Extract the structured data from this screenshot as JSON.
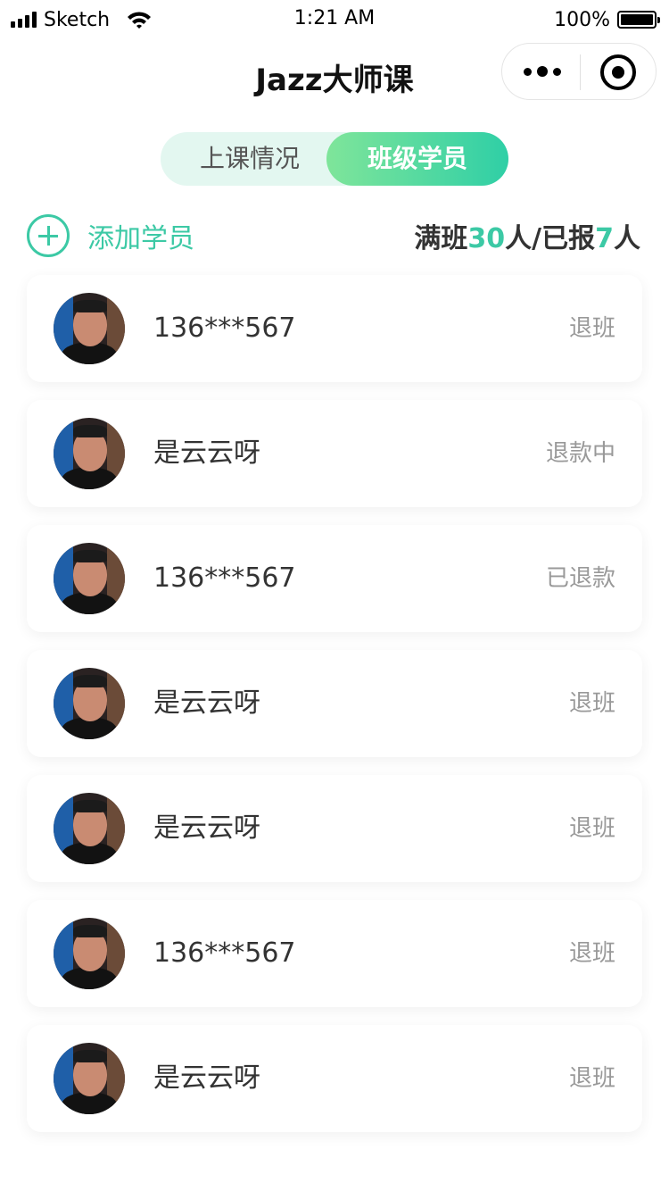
{
  "status_bar": {
    "carrier": "Sketch",
    "time": "1:21 AM",
    "battery": "100%"
  },
  "nav": {
    "title": "Jazz大师课"
  },
  "tabs": [
    {
      "label": "上课情况",
      "active": false
    },
    {
      "label": "班级学员",
      "active": true
    }
  ],
  "actions": {
    "add_label": "添加学员",
    "capacity_prefix": "满班",
    "capacity_total": "30",
    "capacity_mid": "人/已报",
    "capacity_enrolled": "7",
    "capacity_suffix": "人"
  },
  "students": [
    {
      "name": "136***567",
      "action": "退班"
    },
    {
      "name": "是云云呀",
      "action": "退款中"
    },
    {
      "name": "136***567",
      "action": "已退款"
    },
    {
      "name": "是云云呀",
      "action": "退班"
    },
    {
      "name": "是云云呀",
      "action": "退班"
    },
    {
      "name": "136***567",
      "action": "退班"
    },
    {
      "name": "是云云呀",
      "action": "退班"
    }
  ],
  "colors": {
    "accent": "#3cc9a5",
    "tab_gradient_start": "#7fe59a",
    "tab_gradient_end": "#2fcfa6",
    "tab_track": "#e3f7f0",
    "muted_text": "#999999"
  },
  "icons": {
    "add": "plus-circle-icon",
    "menu": "more-dots-icon",
    "close": "target-circle-icon",
    "avatar": "avatar-photo"
  }
}
